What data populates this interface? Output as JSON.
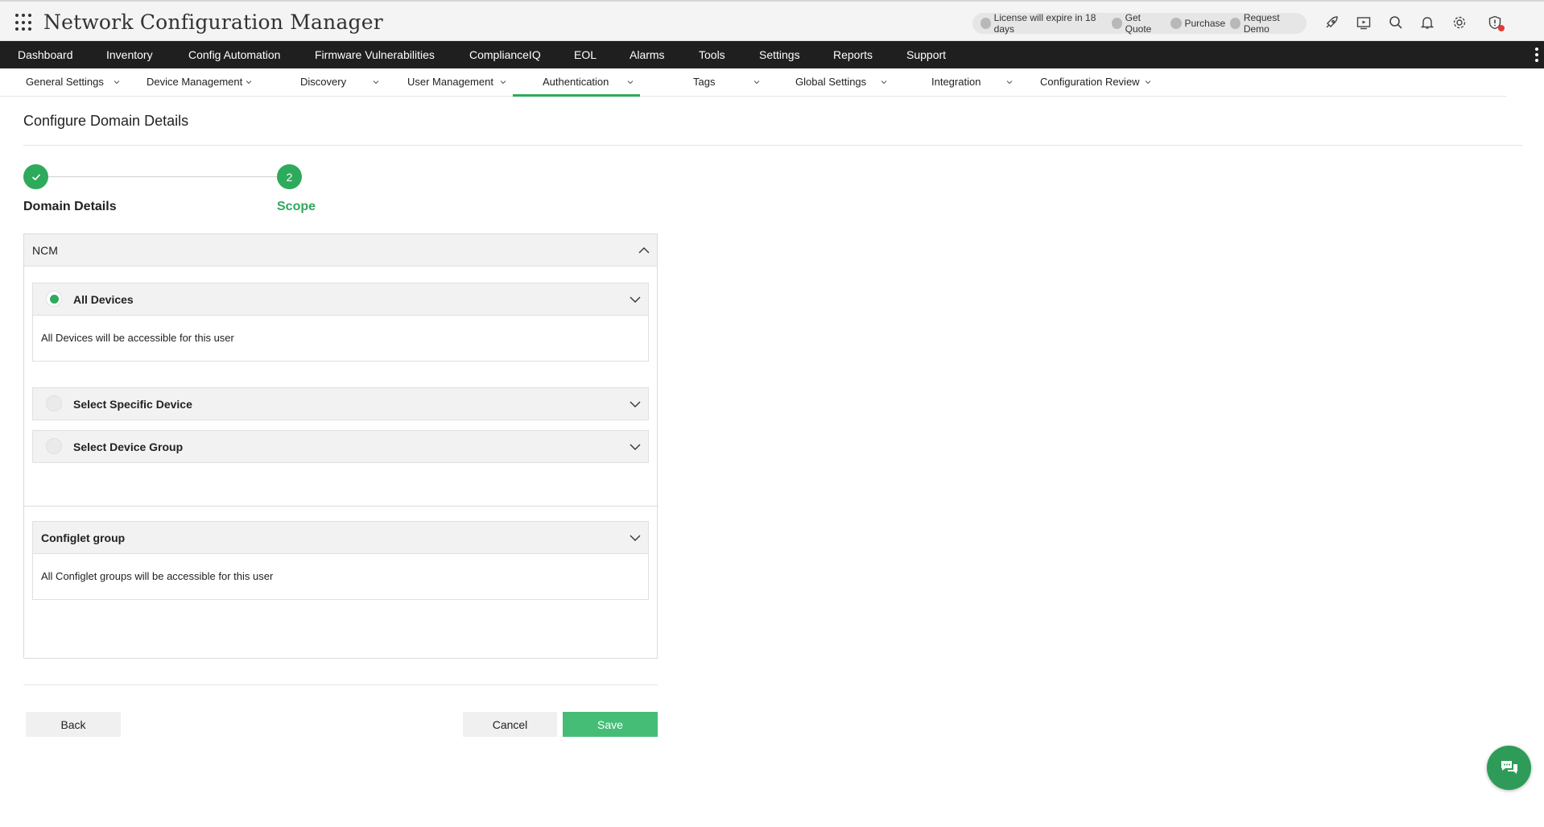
{
  "header": {
    "title": "Network Configuration Manager",
    "license_text": "License will expire in 18 days",
    "get_quote": "Get Quote",
    "purchase": "Purchase",
    "request_demo": "Request Demo",
    "icons": [
      "rocket-icon",
      "video-icon",
      "search-icon",
      "bell-icon",
      "gear-icon",
      "alert-shield-icon"
    ]
  },
  "main_nav": {
    "items": [
      "Dashboard",
      "Inventory",
      "Config Automation",
      "Firmware Vulnerabilities",
      "ComplianceIQ",
      "EOL",
      "Alarms",
      "Tools",
      "Settings",
      "Reports",
      "Support"
    ]
  },
  "sub_nav": {
    "items": [
      "General Settings",
      "Device Management",
      "Discovery",
      "User Management",
      "Authentication",
      "Tags",
      "Global Settings",
      "Integration",
      "Configuration Review"
    ],
    "active": "Authentication"
  },
  "page": {
    "title": "Configure Domain Details"
  },
  "stepper": {
    "step1_label": "Domain Details",
    "step2_number": "2",
    "step2_label": "Scope"
  },
  "scope": {
    "ncm_label": "NCM",
    "all_devices_label": "All Devices",
    "all_devices_desc": "All Devices will be accessible for this user",
    "specific_device_label": "Select Specific Device",
    "device_group_label": "Select Device Group",
    "selected": "All Devices",
    "configlet_label": "Configlet group",
    "configlet_desc": "All Configlet groups will be accessible for this user"
  },
  "buttons": {
    "back": "Back",
    "cancel": "Cancel",
    "save": "Save"
  },
  "colors": {
    "accent": "#2eaa5c",
    "save_button": "#46bd76",
    "nav_bg": "#1f1f1f"
  }
}
